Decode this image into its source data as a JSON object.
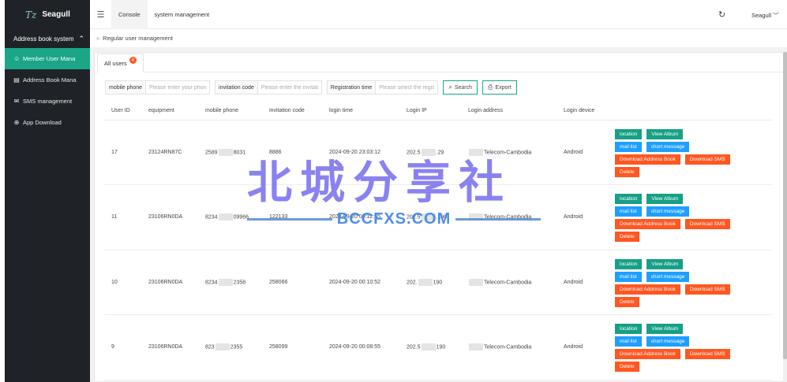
{
  "sidebar": {
    "logo_icon": "Tz",
    "app_name": "Seagull",
    "group_label": "Address book system",
    "items": [
      {
        "icon": "user-icon",
        "glyph": "☺",
        "label": "Member User Mana"
      },
      {
        "icon": "book-icon",
        "glyph": "▤",
        "label": "Address Book Mana"
      },
      {
        "icon": "sms-icon",
        "glyph": "✉",
        "label": "SMS management"
      },
      {
        "icon": "download-icon",
        "glyph": "⊕",
        "label": "App Download"
      }
    ]
  },
  "header": {
    "tabs": [
      "Console",
      "system management"
    ],
    "user": "Seagull"
  },
  "breadcrumb": {
    "current": "Regular user management"
  },
  "subtab": {
    "label": "All users",
    "badge": "4"
  },
  "filters": {
    "mobile_label": "mobile phone",
    "mobile_placeholder": "Please enter your phone",
    "invite_label": "invitation code",
    "invite_placeholder": "Please enter the invitatio",
    "reg_label": "Registration time",
    "reg_placeholder": "Please select the registr",
    "search_label": "Search",
    "export_label": "Export"
  },
  "table": {
    "columns": [
      "User ID",
      "equipment",
      "mobile phone",
      "invitation code",
      "login time",
      "Login IP",
      "Login address",
      "Login device",
      ""
    ],
    "rows": [
      {
        "id": "17",
        "equipment": "23124RN87C",
        "phone_a": "2589",
        "phone_b": "8031",
        "code": "8886",
        "time": "2024-09-20 23:03:12",
        "ip_a": "202.5",
        "ip_b": ".29",
        "address": "Telecom-Cambodia",
        "device": "Android"
      },
      {
        "id": "11",
        "equipment": "23106RN0DA",
        "phone_a": "8234",
        "phone_b": "09966",
        "code": "122133",
        "time": "2024-09-20 00:12:55",
        "ip_a": "202.5",
        "ip_b": ".190",
        "address": "Telecom-Cambodia",
        "device": "Android"
      },
      {
        "id": "10",
        "equipment": "23106RN0DA",
        "phone_a": "8234",
        "phone_b": "2358",
        "code": "258066",
        "time": "2024-09-20 00:10:52",
        "ip_a": "202.",
        "ip_b": "190",
        "address": "Telecom-Cambodia",
        "device": "Android"
      },
      {
        "id": "9",
        "equipment": "23106RN0DA",
        "phone_a": "823",
        "phone_b": "2355",
        "code": "258099",
        "time": "2024-09-20 00:08:55",
        "ip_a": "202.5",
        "ip_b": "190",
        "address": "Telecom-Cambodia",
        "device": "Android"
      }
    ],
    "actions": {
      "location": "location",
      "album": "View Album",
      "mail": "mail list",
      "sms": "short message",
      "dl_book": "Download Address Book",
      "dl_sms": "Download SMS",
      "delete": "Delete"
    }
  },
  "watermark": {
    "cn": "北城分享社",
    "en": "BCCFXS.COM"
  }
}
